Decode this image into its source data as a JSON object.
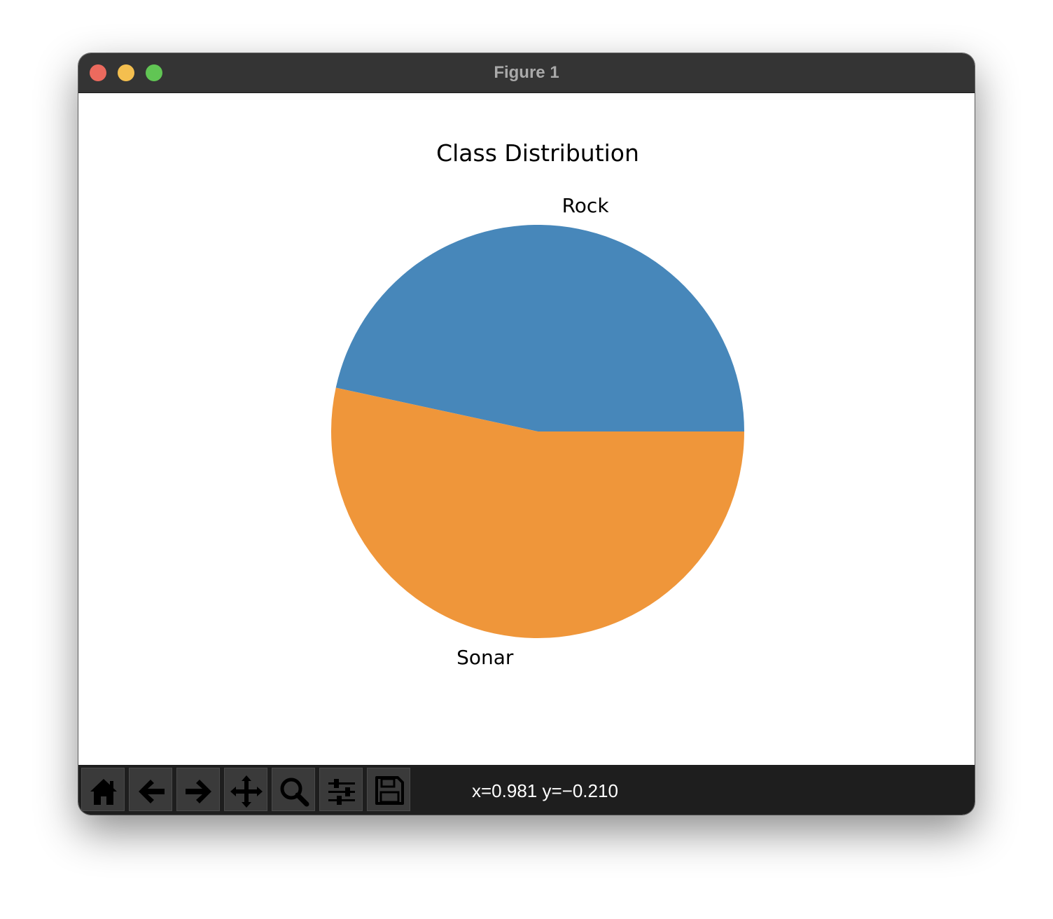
{
  "window": {
    "title": "Figure 1",
    "traffic_colors": {
      "close": "#ec6a5e",
      "minimize": "#f4bf4f",
      "zoom": "#61c554"
    }
  },
  "toolbar": {
    "buttons": [
      {
        "icon": "home-icon",
        "action": "home"
      },
      {
        "icon": "back-arrow-icon",
        "action": "back"
      },
      {
        "icon": "forward-arrow-icon",
        "action": "forward"
      },
      {
        "icon": "pan-move-icon",
        "action": "pan"
      },
      {
        "icon": "zoom-magnifier-icon",
        "action": "zoom"
      },
      {
        "icon": "configure-subplots-icon",
        "action": "configure"
      },
      {
        "icon": "save-floppy-icon",
        "action": "save"
      }
    ],
    "coordinates": "x=0.981 y=−0.210"
  },
  "chart_data": {
    "type": "pie",
    "title": "Class Distribution",
    "labels": [
      "Rock",
      "Sonar"
    ],
    "values": [
      46.6,
      53.4
    ],
    "colors": [
      "#4787ba",
      "#ef963a"
    ],
    "start_angle": 0,
    "direction": "counterclockwise",
    "legend": "none"
  }
}
